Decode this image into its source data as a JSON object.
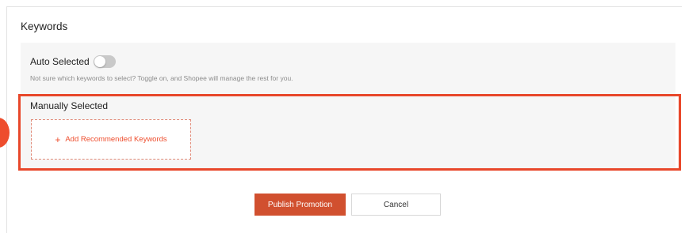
{
  "section": {
    "title": "Keywords"
  },
  "auto_selected": {
    "label": "Auto Selected",
    "toggle_on": false,
    "hint": "Not sure which keywords to select? Toggle on, and Shopee will manage the rest for you."
  },
  "manually_selected": {
    "label": "Manually Selected",
    "add_button_icon": "plus-icon",
    "add_button_label": "Add Recommended Keywords"
  },
  "actions": {
    "publish_label": "Publish Promotion",
    "cancel_label": "Cancel"
  },
  "colors": {
    "accent": "#ee4d2d",
    "highlight": "#e8472a",
    "panel_bg": "#f6f6f6"
  }
}
